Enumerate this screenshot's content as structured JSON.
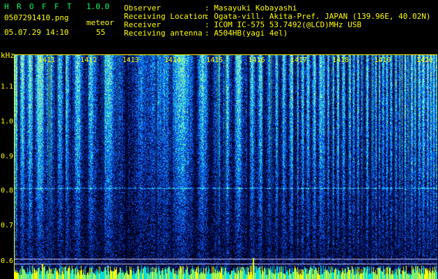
{
  "app": {
    "title_letters": [
      "H",
      "R",
      "O",
      "F",
      "F",
      "T"
    ],
    "version": "1.0.0"
  },
  "file": {
    "name": "0507291410.png",
    "datetime": "05.07.29 14:10",
    "mode_label": "meteor",
    "count": "55"
  },
  "info": {
    "observer_label": "Observer",
    "observer_value": ": Masayuki Kobayashi",
    "location_label": "Receiving Location",
    "location_value": ": Ogata-vill. Akita-Pref. JAPAN (139.96E, 40.02N)",
    "receiver_label": "Receiver",
    "receiver_value": ": ICOM IC-575 53.7492(@LCD)MHz USB",
    "antenna_label": "Receiving antenna",
    "antenna_value": ": A504HB(yagi 4el)"
  },
  "axis": {
    "y_unit": "kHz",
    "y_ticks": [
      "1.1",
      "1.0",
      "0.9",
      "0.8",
      "0.7",
      "0.6"
    ],
    "x_ticks": [
      "1411",
      "1412",
      "1413",
      "1414",
      "1415",
      "1416",
      "1417",
      "1418",
      "1419",
      "1420"
    ]
  },
  "colors": {
    "text_yellow": "#ffff00",
    "text_green": "#00ff66",
    "spectrum_low": "#000033",
    "spectrum_mid": "#1040ff",
    "spectrum_high": "#40ffc0",
    "level_bar": "#ffff00"
  }
}
